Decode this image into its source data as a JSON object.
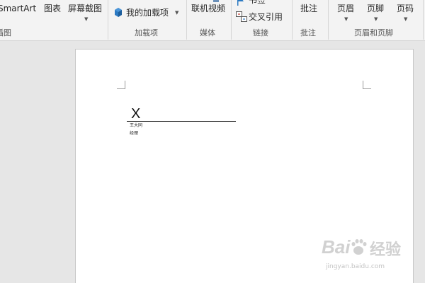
{
  "ribbon": {
    "illustrations": {
      "smartart": "SmartArt",
      "chart": "图表",
      "screenshot": "屏幕截图",
      "group_label": "插图"
    },
    "addins": {
      "my_addins": "我的加载项",
      "group_label": "加载项",
      "icon": "store-bag-icon"
    },
    "media": {
      "online_video": "联机视频",
      "group_label": "媒体"
    },
    "links": {
      "bookmark": "书签",
      "cross_reference": "交叉引用",
      "group_label": "链接",
      "bookmark_icon": "bookmark-flag-icon",
      "crossref_icon": "cross-reference-icon"
    },
    "comments": {
      "comment": "批注",
      "group_label": "批注"
    },
    "header_footer": {
      "header": "页眉",
      "footer": "页脚",
      "page_number": "页码",
      "group_label": "页眉和页脚"
    }
  },
  "document": {
    "signature_mark": "X",
    "signer_name": "王大同",
    "signer_title": "经理"
  },
  "watermark": {
    "url": "jingyan.baidu.com"
  },
  "colors": {
    "ribbon_bg": "#f3f3f3",
    "workspace_bg": "#e6e6e6",
    "page_bg": "#ffffff",
    "addin_icon": "#2b79c2"
  }
}
